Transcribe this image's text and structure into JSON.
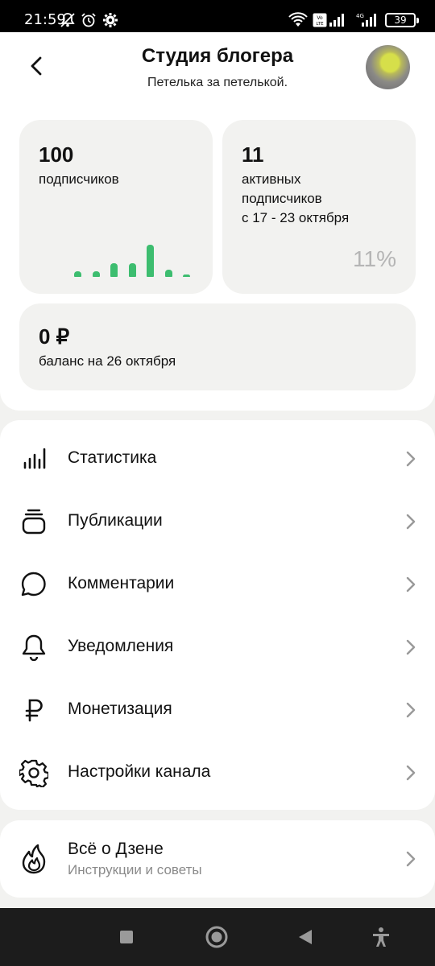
{
  "status_bar": {
    "time": "21:59",
    "battery": "39",
    "icons": [
      "notifications-off-icon",
      "alarm-icon",
      "gear-icon",
      "wifi-icon",
      "volte-icon",
      "signal-icon",
      "4g-signal-icon",
      "battery-icon"
    ]
  },
  "header": {
    "title": "Студия блогера",
    "subtitle": "Петелька за петелькой.",
    "back_icon": "back-arrow-icon",
    "avatar_icon": "avatar"
  },
  "stats": {
    "subscribers": {
      "value": "100",
      "label": "подписчиков",
      "sparkline": [
        0.17,
        0.17,
        0.43,
        0.43,
        1.0,
        0.22,
        0.05
      ]
    },
    "active": {
      "value": "11",
      "label_line1": "активных",
      "label_line2": "подписчиков",
      "label_line3": "с 17 - 23 октября",
      "percent": "11%"
    },
    "balance": {
      "value": "0 ₽",
      "label": "баланс на 26 октября"
    }
  },
  "menu": {
    "items": [
      {
        "label": "Статистика",
        "icon": "bar-chart-icon"
      },
      {
        "label": "Публикации",
        "icon": "publications-stack-icon"
      },
      {
        "label": "Комментарии",
        "icon": "comment-bubble-icon"
      },
      {
        "label": "Уведомления",
        "icon": "bell-icon"
      },
      {
        "label": "Монетизация",
        "icon": "ruble-icon"
      },
      {
        "label": "Настройки канала",
        "icon": "gear-icon"
      }
    ]
  },
  "about": {
    "title": "Всё о Дзене",
    "subtitle": "Инструкции и советы",
    "icon": "flame-icon"
  },
  "navbar": {
    "icons": [
      "recents-square-icon",
      "home-circle-icon",
      "back-triangle-icon",
      "accessibility-icon"
    ]
  },
  "colors": {
    "accent_green": "#3dbd6f",
    "background": "#f2f2f0",
    "card": "#ffffff"
  }
}
